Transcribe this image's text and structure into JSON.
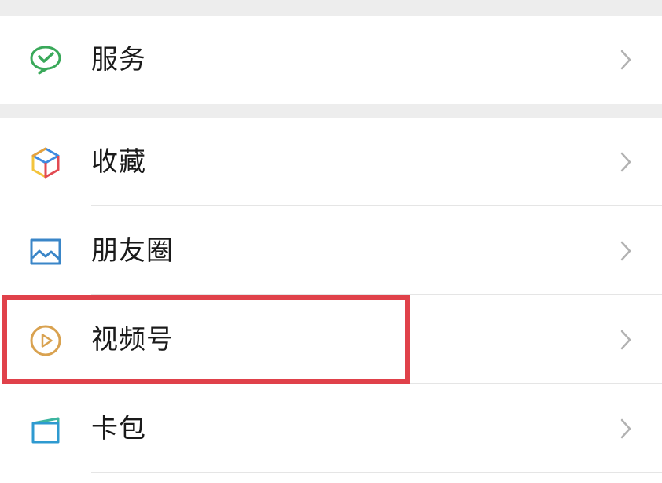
{
  "menu": {
    "services": {
      "label": "服务",
      "icon": "wechat-pay-icon",
      "color": "#3aa95a"
    },
    "favorites": {
      "label": "收藏",
      "icon": "cube-icon",
      "colors": [
        "#e8a23a",
        "#3e8ae0",
        "#e24a52",
        "#f3c43c"
      ]
    },
    "moments": {
      "label": "朋友圈",
      "icon": "picture-icon",
      "color": "#3a86c8"
    },
    "channels": {
      "label": "视频号",
      "icon": "play-circle-icon",
      "color": "#d9a250"
    },
    "cards": {
      "label": "卡包",
      "icon": "card-wallet-icon",
      "color": "#2e9ad0"
    }
  },
  "highlight_color": "#e0414a",
  "chevron_icon": "chevron-right-icon"
}
